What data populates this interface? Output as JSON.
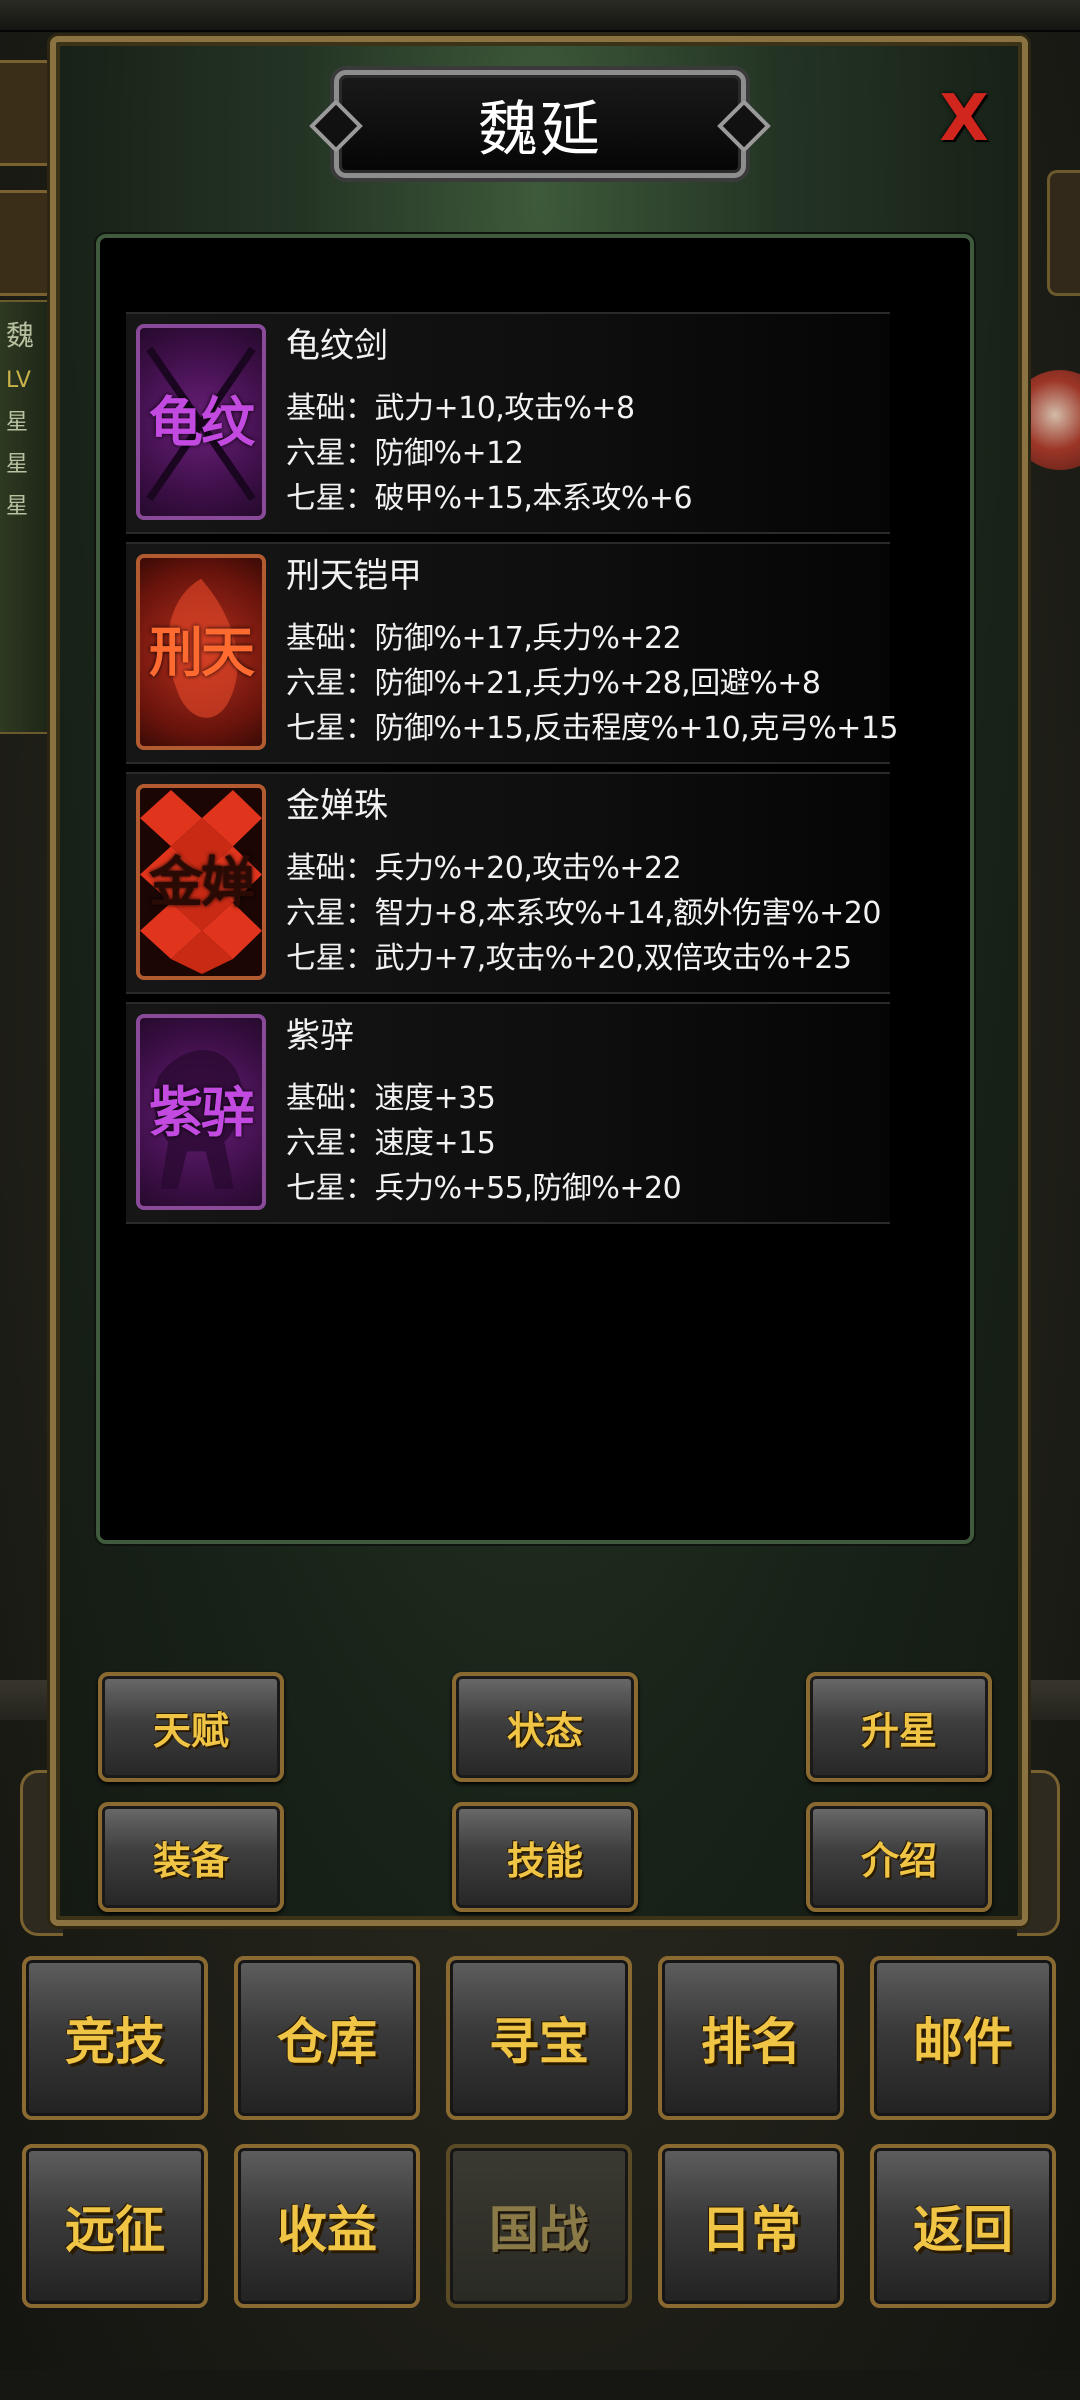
{
  "dialog": {
    "title": "魏延",
    "close_label": "X"
  },
  "background": {
    "left_strip": [
      "魏",
      "LV",
      "星",
      "星",
      "星"
    ]
  },
  "equipment": [
    {
      "name": "龟纹剑",
      "icon_text": "龟纹",
      "icon_color": "purple",
      "stats": [
        "基础：武力+10,攻击%+8",
        "六星：防御%+12",
        "七星：破甲%+15,本系攻%+6"
      ]
    },
    {
      "name": "刑天铠甲",
      "icon_text": "刑天",
      "icon_color": "red",
      "stats": [
        "基础：防御%+17,兵力%+22",
        "六星：防御%+21,兵力%+28,回避%+8",
        "七星：防御%+15,反击程度%+10,克弓%+15"
      ]
    },
    {
      "name": "金婵珠",
      "icon_text": "金婵",
      "icon_color": "orange",
      "stats": [
        "基础：兵力%+20,攻击%+22",
        "六星：智力+8,本系攻%+14,额外伤害%+20",
        "七星：武力+7,攻击%+20,双倍攻击%+25"
      ]
    },
    {
      "name": "紫骍",
      "icon_text": "紫骍",
      "icon_color": "purple",
      "stats": [
        "基础：速度+35",
        "六星：速度+15",
        "七星：兵力%+55,防御%+20"
      ]
    }
  ],
  "dialog_buttons": {
    "talent": "天赋",
    "status": "状态",
    "star_up": "升星",
    "equipment": "装备",
    "skills": "技能",
    "intro": "介绍"
  },
  "bottom_nav": {
    "arena": "竞技",
    "warehouse": "仓库",
    "treasure": "寻宝",
    "ranking": "排名",
    "mail": "邮件",
    "expedition": "远征",
    "income": "收益",
    "nation_war": "国战",
    "daily": "日常",
    "back": "返回"
  }
}
